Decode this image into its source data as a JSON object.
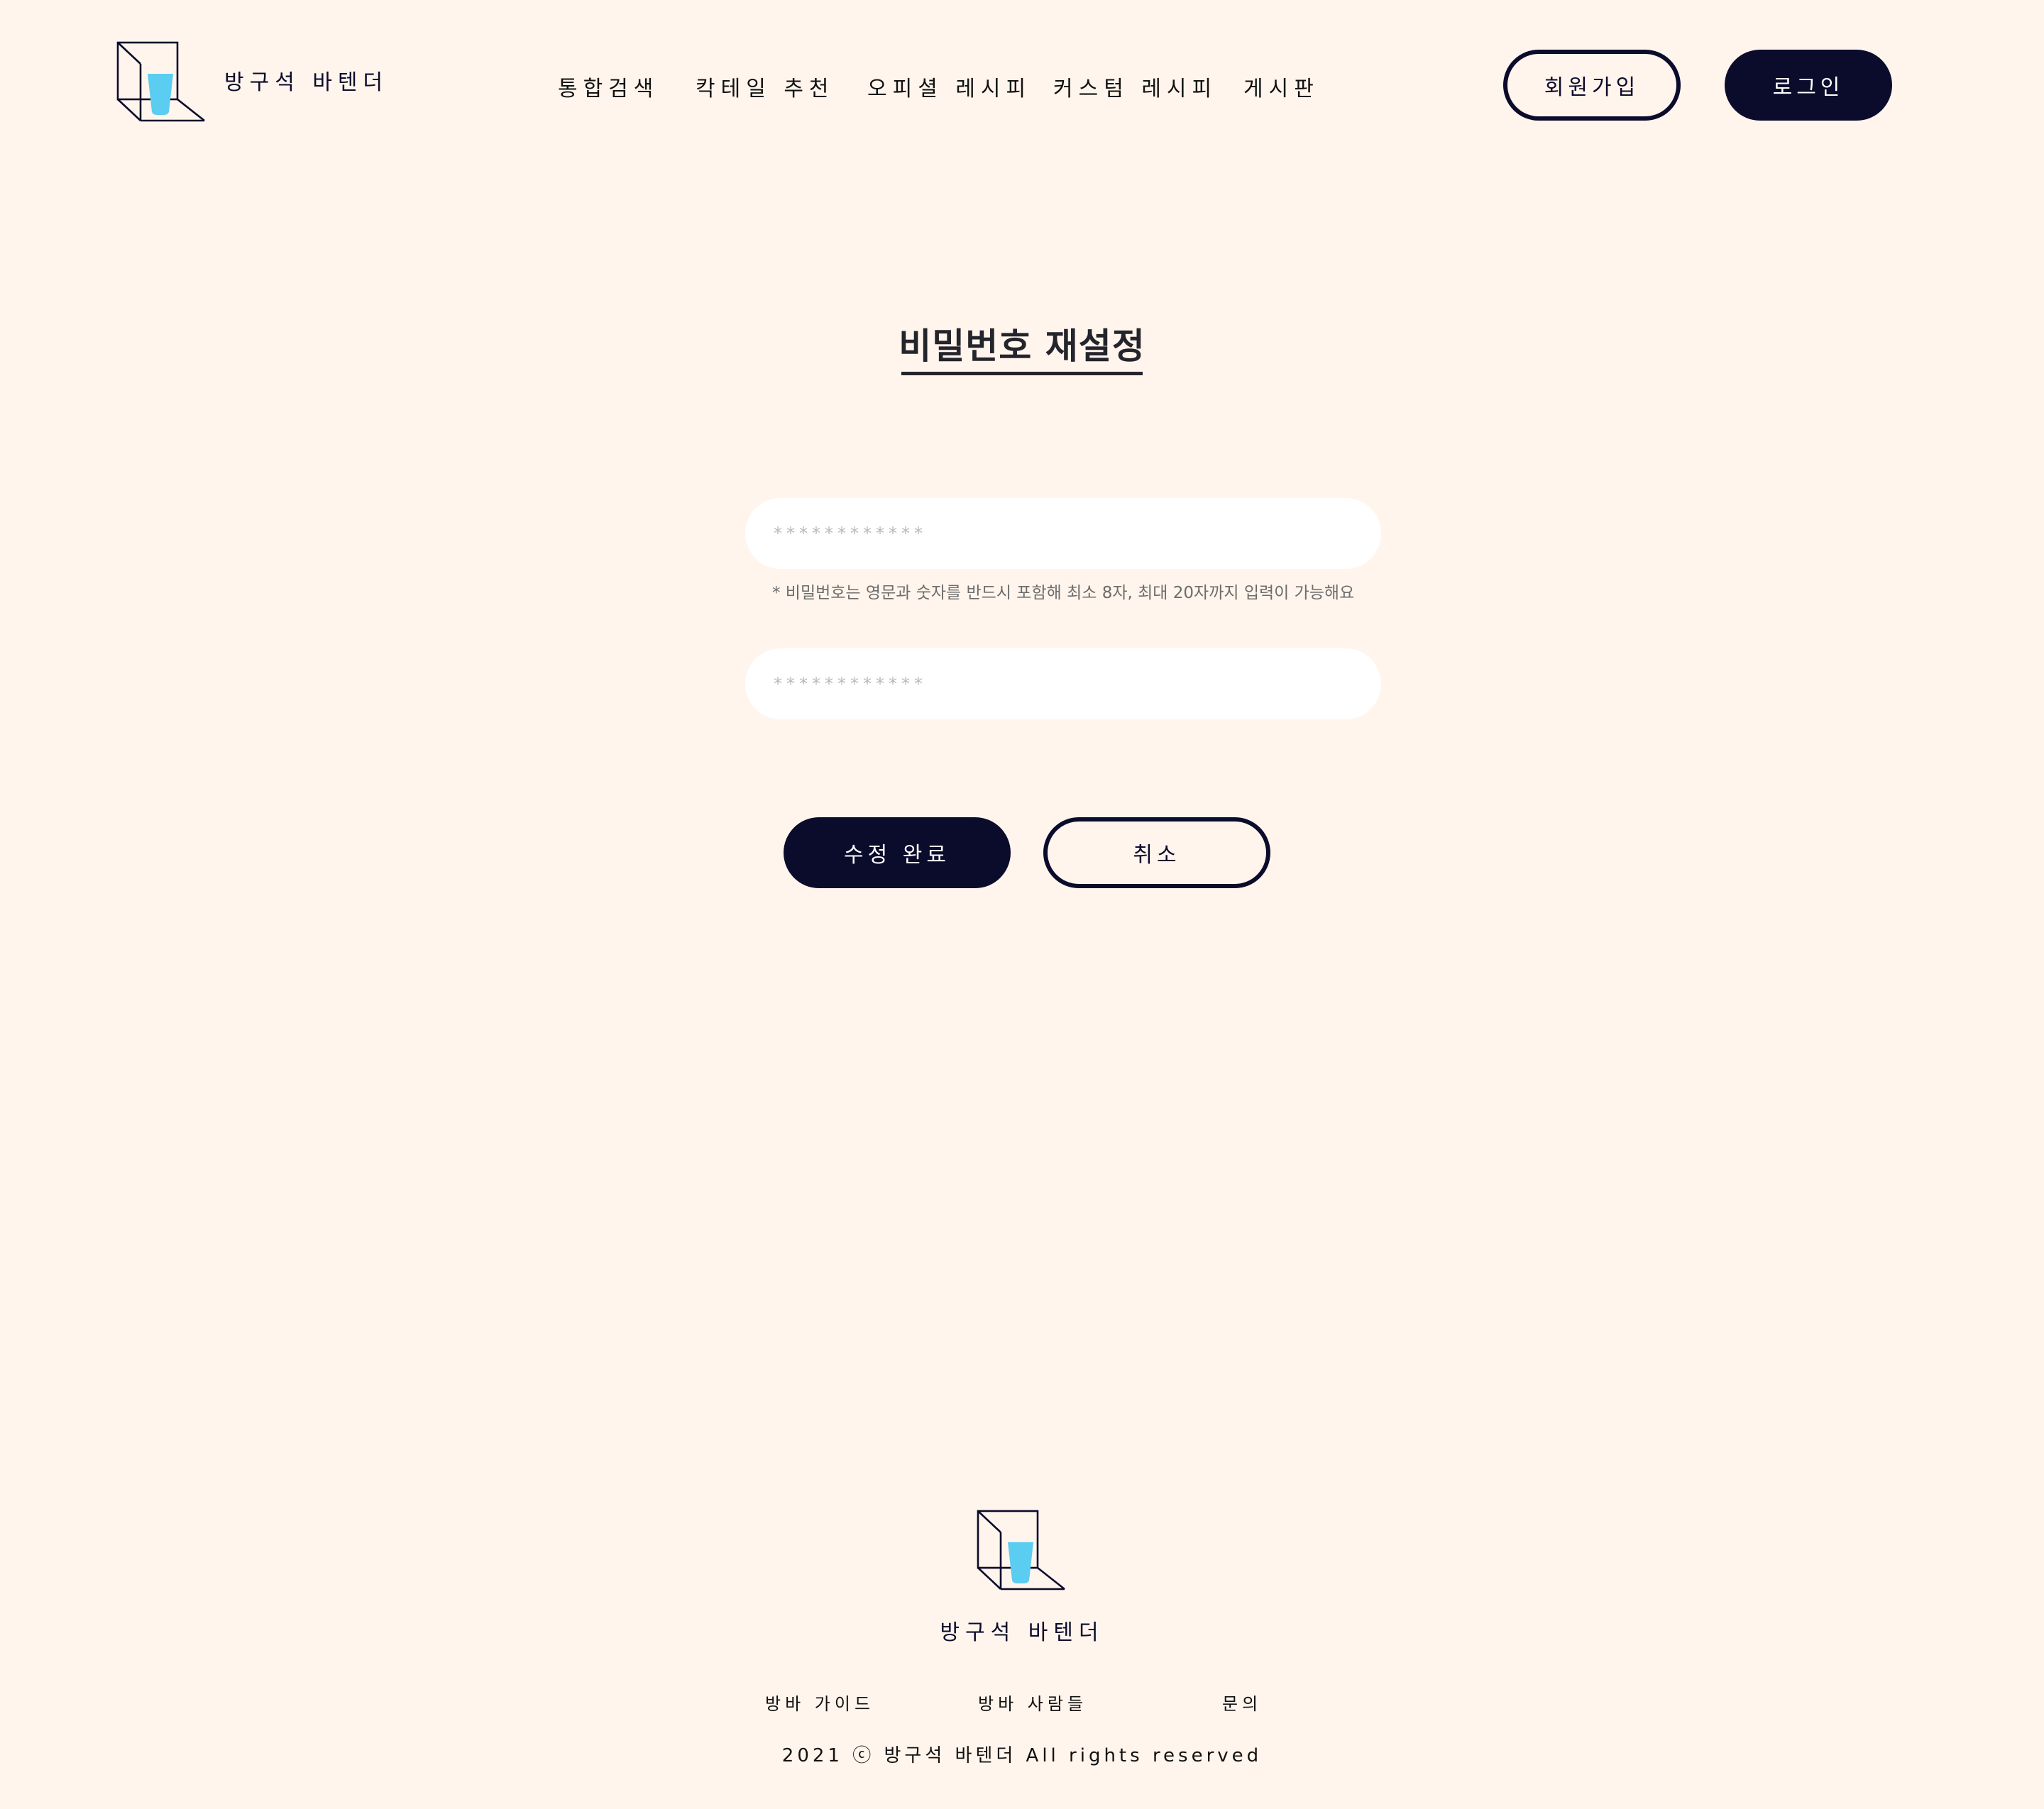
{
  "brand": {
    "name": "방구석 바텐더"
  },
  "nav": {
    "items": [
      {
        "label": "통합검색"
      },
      {
        "label": "칵테일 추천"
      },
      {
        "label": "오피셜 레시피"
      },
      {
        "label": "커스텀 레시피"
      },
      {
        "label": "게시판"
      }
    ]
  },
  "auth": {
    "signup_label": "회원가입",
    "login_label": "로그인"
  },
  "main": {
    "title": "비밀번호 재설정",
    "new_password": {
      "placeholder": "************",
      "value": ""
    },
    "password_hint": "* 비밀번호는 영문과 숫자를 반드시 포함해 최소 8자, 최대 20자까지 입력이 가능해요",
    "confirm_password": {
      "placeholder": "************",
      "value": ""
    },
    "submit_label": "수정 완료",
    "cancel_label": "취소"
  },
  "footer": {
    "brand": "방구석 바텐더",
    "links": [
      {
        "label": "방바 가이드"
      },
      {
        "label": "방바 사람들"
      },
      {
        "label": "문의"
      }
    ],
    "copyright": "2021 ⓒ 방구석 바텐더 All rights reserved"
  },
  "colors": {
    "background": "#fff5ec",
    "primary": "#0b0b2c",
    "glass": "#5bcdf0",
    "field": "#ffffff"
  },
  "icons": {
    "logo": "cube-glass-logo-icon"
  }
}
